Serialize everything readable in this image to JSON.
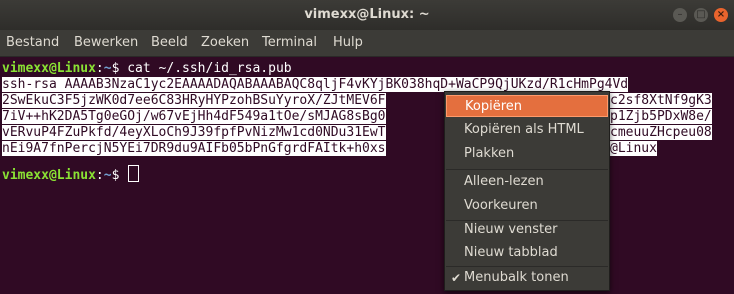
{
  "window": {
    "title": "vimexx@Linux: ~",
    "buttons": {
      "minimize": "–",
      "maximize": "□",
      "close": "×"
    }
  },
  "menubar": [
    "Bestand",
    "Bewerken",
    "Beeld",
    "Zoeken",
    "Terminal",
    "Hulp"
  ],
  "terminal": {
    "prompt_user": "vimexx@Linux",
    "prompt_sep": ":",
    "prompt_path": "~",
    "prompt_dollar": "$ ",
    "command": "cat ~/.ssh/id_rsa.pub",
    "output_lines": [
      "ssh-rsa AAAAB3NzaC1yc2EAAAADAQABAAABAQC8qljF4vKYjBK038hqD+WaCP9QjUKzd/R1cHmPg4Vd",
      "2SwEkuC3F5jzWK0d7ee6C83HRyHYPzohBSuYyroX/ZJtMEV6F",
      "7iV++hK2DA5Tg0eGOj/w67vEjHh4dF549a1tOe/sMJAG8sBg0",
      "vERvuP4FZuPkfd/4eyXLoCh9J39fpfPvNizMw1cd0NDu31EwT",
      "nEi9A7fnPercjN5YEi7DR9du9AIFb05bPnGfgrdFAItk+h0xs"
    ],
    "output_tails": [
      "",
      "c2sf8XtNf9gK3",
      "p1Zjb5PDxW8e/",
      "cmeuuZHcpeu08",
      "@Linux"
    ]
  },
  "context_menu": {
    "items": [
      {
        "label": "Kopiëren",
        "highlighted": true
      },
      {
        "label": "Kopiëren als HTML"
      },
      {
        "label": "Plakken"
      },
      {
        "label": "Alleen-lezen"
      },
      {
        "label": "Voorkeuren"
      },
      {
        "label": "Nieuw venster"
      },
      {
        "label": "Nieuw tabblad"
      },
      {
        "label": "Menubalk tonen",
        "checked": true
      }
    ],
    "check_mark": "✔"
  },
  "colors": {
    "terminal_bg": "#300a24",
    "prompt_user": "#8ae234",
    "prompt_path": "#729fcf",
    "menu_highlight": "#e46f3e"
  }
}
